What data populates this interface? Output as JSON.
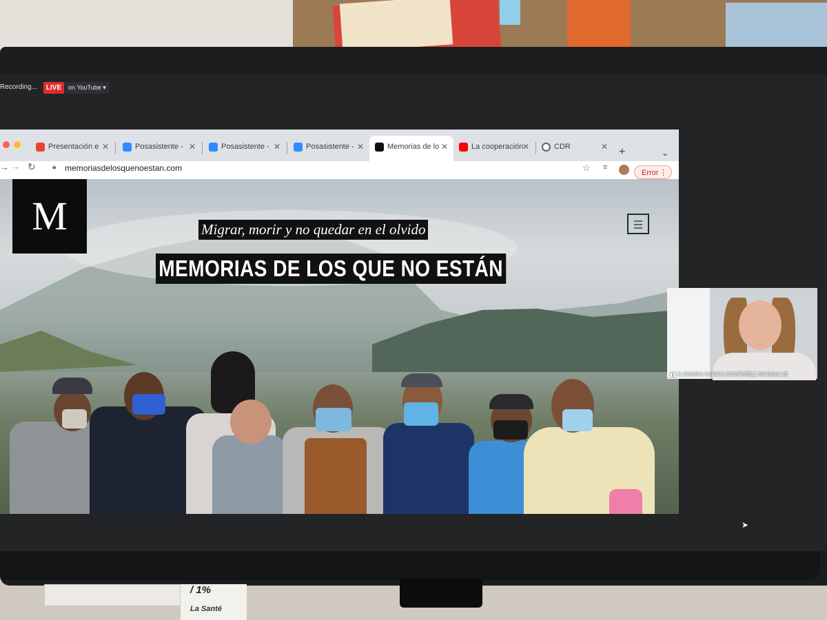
{
  "zoom_bar": {
    "recording_label": "Recording...",
    "live_badge": "LIVE",
    "youtube_label": "on YouTube ▾"
  },
  "browser": {
    "tabs": [
      {
        "label": "Presentación e",
        "icon": "gmail-icon",
        "icon_color": "#ea4335"
      },
      {
        "label": "Posasistente - ",
        "icon": "zoom-icon",
        "icon_color": "#2d8cff"
      },
      {
        "label": "Posasistente - ",
        "icon": "zoom-icon",
        "icon_color": "#2d8cff"
      },
      {
        "label": "Posasistente - ",
        "icon": "zoom-icon",
        "icon_color": "#2d8cff"
      },
      {
        "label": "Memorias de lo",
        "icon": "m-site-icon",
        "icon_color": "#111111"
      },
      {
        "label": "La cooperación",
        "icon": "youtube-icon",
        "icon_color": "#ff0000"
      },
      {
        "label": "CDR",
        "icon": "cdr-icon",
        "icon_color": "#5f6368"
      }
    ],
    "active_tab_index": 4,
    "new_tab_glyph": "+",
    "url": "memoriasdelosquenoestan.com",
    "error_label": "Error"
  },
  "page": {
    "logo_letter": "M",
    "subtitle": "Migrar, morir y no quedar en el olvido",
    "title": "MEMORIAS DE LOS QUE NO ESTÁN"
  },
  "zoom_participant": {
    "name": "X.OMARA KARINA MONTAÑEZ MONSALVE"
  },
  "desk": {
    "box_percent": "/ 1%",
    "box_brand": "La Santé"
  },
  "colors": {
    "live_red": "#e02c2c",
    "error_red": "#c5221f",
    "title_bg": "#111111"
  }
}
